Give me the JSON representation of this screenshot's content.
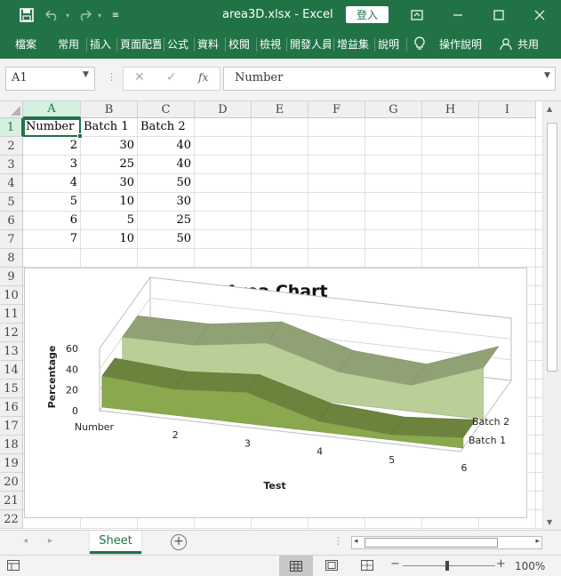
{
  "titlebar": {
    "save_icon": "save-icon",
    "undo_icon": "undo-icon",
    "redo_icon": "redo-icon",
    "customize_icon": "customize-icon",
    "title": "area3D.xlsx  -  Excel",
    "login_label": "登入",
    "ribbon_display_icon": "ribbon-display-icon",
    "minimize_icon": "minimize-icon",
    "maximize_icon": "maximize-icon",
    "close_icon": "close-icon"
  },
  "ribbon": {
    "tabs": [
      "檔案",
      "常用",
      "插入",
      "頁面配置",
      "公式",
      "資料",
      "校閱",
      "檢視",
      "開發人員",
      "增益集",
      "說明"
    ],
    "tell_me_icon": "lightbulb-icon",
    "tell_me_label": "操作說明",
    "share_icon": "user-icon",
    "share_label": "共用"
  },
  "formula_bar": {
    "name_box_value": "A1",
    "cancel_icon": "✕",
    "enter_icon": "✓",
    "fx_label": "fx",
    "formula_value": "Number"
  },
  "grid": {
    "columns": [
      "A",
      "B",
      "C",
      "D",
      "E",
      "F",
      "G",
      "H",
      "I"
    ],
    "rows": [
      "1",
      "2",
      "3",
      "4",
      "5",
      "6",
      "7",
      "8",
      "9",
      "10",
      "11",
      "12",
      "13",
      "14",
      "15",
      "16",
      "17",
      "18",
      "19",
      "20",
      "21",
      "22"
    ],
    "cells": [
      [
        "Number",
        "Batch 1",
        "Batch 2"
      ],
      [
        "2",
        "30",
        "40"
      ],
      [
        "3",
        "25",
        "40"
      ],
      [
        "4",
        "30",
        "50"
      ],
      [
        "5",
        "10",
        "30"
      ],
      [
        "6",
        "5",
        "25"
      ],
      [
        "7",
        "10",
        "50"
      ]
    ]
  },
  "chart_data": {
    "type": "area",
    "title": "Area Chart",
    "xlabel": "Test",
    "ylabel": "Percentage",
    "categories": [
      "Number",
      "2",
      "3",
      "4",
      "5",
      "6"
    ],
    "yticks": [
      "0",
      "20",
      "40",
      "60"
    ],
    "ylim": [
      0,
      60
    ],
    "series": [
      {
        "name": "Batch 1",
        "values": [
          30,
          25,
          30,
          10,
          5,
          10
        ],
        "color": "#8aa84e"
      },
      {
        "name": "Batch 2",
        "values": [
          40,
          40,
          50,
          30,
          25,
          50
        ],
        "color": "#b9cf97"
      }
    ],
    "legend": "right"
  },
  "sheets": {
    "tabs": [
      "Sheet"
    ],
    "add_icon": "plus-circle-icon"
  },
  "statusbar": {
    "zoom_label": "100%",
    "minus": "−",
    "plus": "+"
  },
  "colors": {
    "accent": "#217346",
    "batch1": "#8aa84e",
    "batch2": "#b9cf97"
  }
}
